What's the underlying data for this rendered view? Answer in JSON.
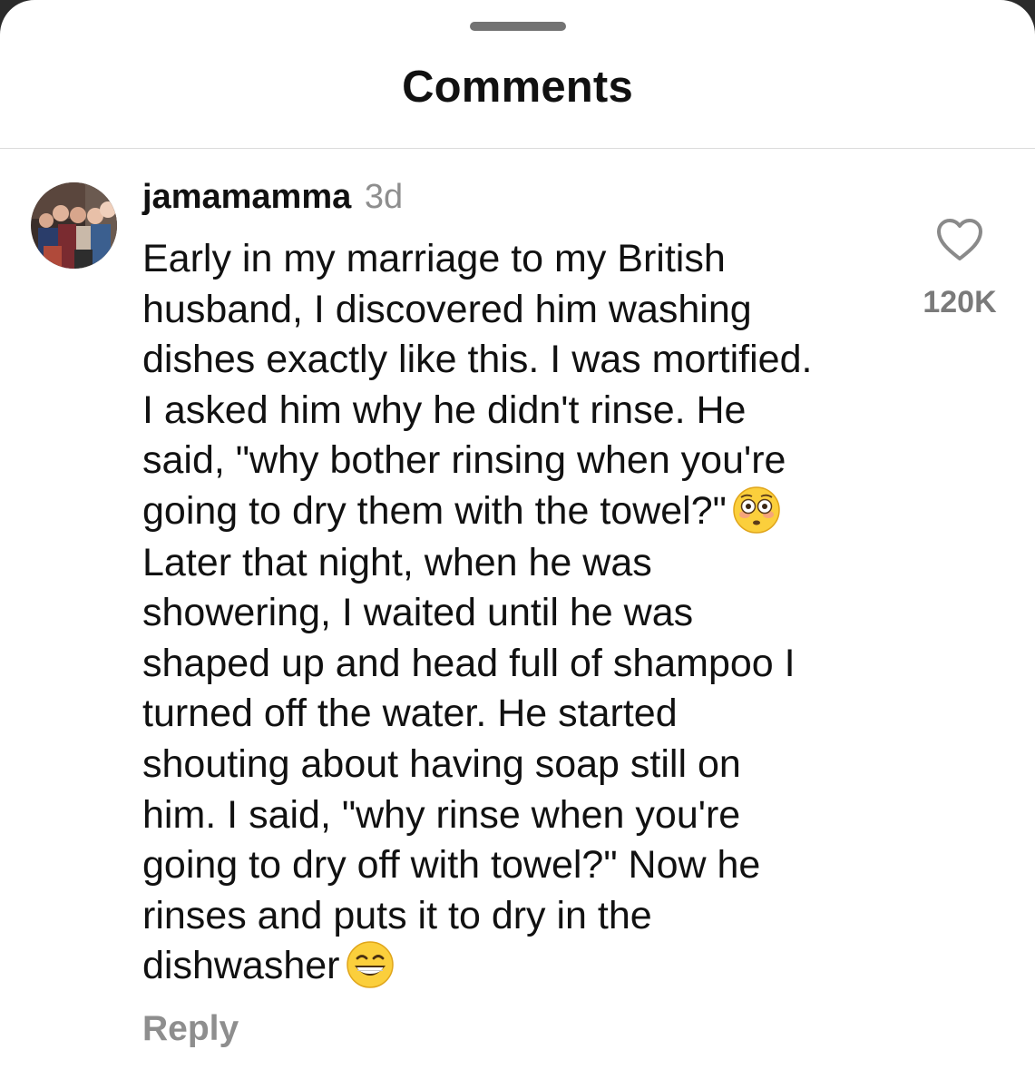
{
  "sheet": {
    "title": "Comments"
  },
  "comment": {
    "username": "jamamamma",
    "time": "3d",
    "text_part1": "Early in my marriage to my British\nhusband, I discovered him washing\ndishes exactly like this. I was mortified.\nI asked him why he didn't rinse. He\nsaid, \"why bother rinsing when you're\ngoing to dry them with the towel?\"",
    "emoji1": "flushed-face",
    "text_part2": "\nLater that night, when he was\nshowering, I  waited until he was\nshaped up and head full of shampoo I\nturned off the water. He started\nshouting about having soap still on\nhim. I said, \"why rinse when you're\ngoing to dry off with towel?\" Now he\nrinses and puts it to dry in the\ndishwasher",
    "emoji2": "grinning-face",
    "like_icon": "heart-outline-icon",
    "like_count": "120K",
    "reply_label": "Reply"
  },
  "colors": {
    "primary_text": "#111111",
    "secondary_text": "#8e8e8e",
    "divider": "#dcdcdc",
    "grabber": "#737373"
  }
}
